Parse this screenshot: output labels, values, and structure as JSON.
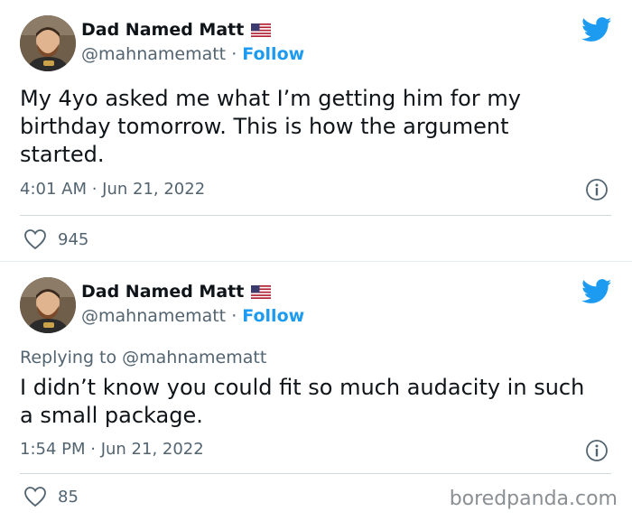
{
  "tweets": [
    {
      "author_name": "Dad Named Matt",
      "handle": "@mahnamematt",
      "follow_label": "Follow",
      "dot": "·",
      "flag_icon": "us-flag-icon",
      "reply_prefix": "",
      "reply_mention": "",
      "text": "My 4yo asked me what I’m getting him for my birthday tomorrow. This is how the argument started.",
      "time": "4:01 AM · Jun 21, 2022",
      "likes": "945"
    },
    {
      "author_name": "Dad Named Matt",
      "handle": "@mahnamematt",
      "follow_label": "Follow",
      "dot": "·",
      "flag_icon": "us-flag-icon",
      "reply_prefix": "Replying to ",
      "reply_mention": "@mahnamematt",
      "text": "I didn’t know you could fit so much audacity in such a small package.",
      "time": "1:54 PM · Jun 21, 2022",
      "likes": "85"
    }
  ],
  "watermark": "boredpanda.com",
  "colors": {
    "twitter_blue": "#1d9bf0",
    "secondary_text": "#536471"
  }
}
